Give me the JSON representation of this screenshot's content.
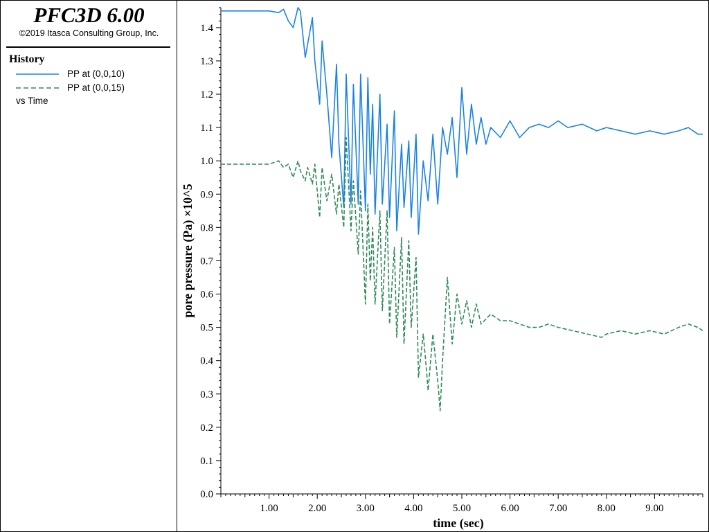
{
  "header": {
    "app_title": "PFC3D 6.00",
    "copyright": "©2019 Itasca Consulting Group, Inc."
  },
  "legend": {
    "heading": "History",
    "entries": [
      {
        "label": "PP at (0,0,10)",
        "color": "#1a82e6",
        "style": "solid"
      },
      {
        "label": "PP at (0,0,15)",
        "color": "#2e8b57",
        "style": "dashed"
      }
    ],
    "vs_label": "vs Time"
  },
  "chart_data": {
    "type": "line",
    "xlabel": "time (sec)",
    "ylabel": "pore pressure (Pa) ×10^5",
    "xlim": [
      0,
      10
    ],
    "ylim": [
      0,
      1.46
    ],
    "x_ticks": [
      1,
      2,
      3,
      4,
      5,
      6,
      7,
      8,
      9
    ],
    "x_tick_labels": [
      "1.00",
      "2.00",
      "3.00",
      "4.00",
      "5.00",
      "6.00",
      "7.00",
      "8.00",
      "9.00"
    ],
    "y_ticks": [
      0,
      0.1,
      0.2,
      0.3,
      0.4,
      0.5,
      0.6,
      0.7,
      0.8,
      0.9,
      1.0,
      1.1,
      1.2,
      1.3,
      1.4
    ],
    "y_tick_labels": [
      "0.0",
      "0.1",
      "0.2",
      "0.3",
      "0.4",
      "0.5",
      "0.6",
      "0.7",
      "0.8",
      "0.9",
      "1.0",
      "1.1",
      "1.2",
      "1.3",
      "1.4"
    ],
    "grid": false,
    "series": [
      {
        "name": "PP at (0,0,10)",
        "color": "#1a82e6",
        "dashed": false,
        "x": [
          0.0,
          0.5,
          1.0,
          1.2,
          1.3,
          1.4,
          1.5,
          1.6,
          1.65,
          1.75,
          1.8,
          1.9,
          1.95,
          2.05,
          2.1,
          2.2,
          2.3,
          2.4,
          2.45,
          2.55,
          2.6,
          2.7,
          2.75,
          2.85,
          2.9,
          3.0,
          3.05,
          3.1,
          3.15,
          3.2,
          3.3,
          3.35,
          3.45,
          3.5,
          3.6,
          3.65,
          3.75,
          3.8,
          3.9,
          3.95,
          4.05,
          4.1,
          4.2,
          4.3,
          4.4,
          4.5,
          4.6,
          4.7,
          4.8,
          4.9,
          5.0,
          5.1,
          5.2,
          5.3,
          5.4,
          5.5,
          5.6,
          5.8,
          6.0,
          6.2,
          6.4,
          6.6,
          6.8,
          7.0,
          7.2,
          7.5,
          7.8,
          8.0,
          8.3,
          8.6,
          8.9,
          9.2,
          9.5,
          9.7,
          9.9,
          10.0
        ],
        "y": [
          1.45,
          1.45,
          1.45,
          1.445,
          1.455,
          1.42,
          1.4,
          1.46,
          1.45,
          1.31,
          1.35,
          1.43,
          1.3,
          1.17,
          1.36,
          1.2,
          1.01,
          1.29,
          1.05,
          0.86,
          1.26,
          0.87,
          1.23,
          0.87,
          1.26,
          0.85,
          1.25,
          0.96,
          1.17,
          0.84,
          1.2,
          0.87,
          1.11,
          0.83,
          1.15,
          0.79,
          1.05,
          0.86,
          1.06,
          0.83,
          1.08,
          0.78,
          1.0,
          0.88,
          1.08,
          0.87,
          1.1,
          1.02,
          1.13,
          0.95,
          1.22,
          1.02,
          1.17,
          1.05,
          1.13,
          1.05,
          1.1,
          1.07,
          1.12,
          1.07,
          1.1,
          1.11,
          1.1,
          1.12,
          1.1,
          1.11,
          1.09,
          1.1,
          1.09,
          1.08,
          1.09,
          1.08,
          1.09,
          1.1,
          1.08,
          1.08
        ]
      },
      {
        "name": "PP at (0,0,15)",
        "color": "#2e8b57",
        "dashed": true,
        "x": [
          0.0,
          0.5,
          1.0,
          1.2,
          1.3,
          1.4,
          1.5,
          1.6,
          1.65,
          1.75,
          1.8,
          1.9,
          1.95,
          2.05,
          2.1,
          2.2,
          2.3,
          2.4,
          2.45,
          2.55,
          2.6,
          2.7,
          2.75,
          2.85,
          2.9,
          3.0,
          3.05,
          3.1,
          3.15,
          3.2,
          3.3,
          3.35,
          3.45,
          3.5,
          3.6,
          3.65,
          3.75,
          3.8,
          3.9,
          3.95,
          4.05,
          4.1,
          4.2,
          4.25,
          4.3,
          4.4,
          4.5,
          4.55,
          4.6,
          4.7,
          4.8,
          4.9,
          5.0,
          5.1,
          5.2,
          5.3,
          5.4,
          5.6,
          5.8,
          6.0,
          6.2,
          6.4,
          6.6,
          6.8,
          7.0,
          7.3,
          7.6,
          7.9,
          8.0,
          8.3,
          8.6,
          8.9,
          9.2,
          9.5,
          9.7,
          9.9,
          10.0
        ],
        "y": [
          0.99,
          0.99,
          0.99,
          1.0,
          0.98,
          0.99,
          0.95,
          1.0,
          0.97,
          0.94,
          0.98,
          0.93,
          0.99,
          0.83,
          0.98,
          0.88,
          0.96,
          0.84,
          0.93,
          0.8,
          1.07,
          0.79,
          0.94,
          0.72,
          0.91,
          0.57,
          0.87,
          0.64,
          0.8,
          0.57,
          0.85,
          0.55,
          0.85,
          0.51,
          0.74,
          0.47,
          0.77,
          0.45,
          0.76,
          0.5,
          0.71,
          0.35,
          0.48,
          0.4,
          0.31,
          0.48,
          0.34,
          0.25,
          0.4,
          0.65,
          0.45,
          0.6,
          0.51,
          0.58,
          0.5,
          0.57,
          0.51,
          0.54,
          0.52,
          0.52,
          0.51,
          0.5,
          0.5,
          0.51,
          0.5,
          0.49,
          0.48,
          0.47,
          0.48,
          0.49,
          0.48,
          0.49,
          0.48,
          0.5,
          0.51,
          0.5,
          0.49
        ]
      }
    ]
  }
}
